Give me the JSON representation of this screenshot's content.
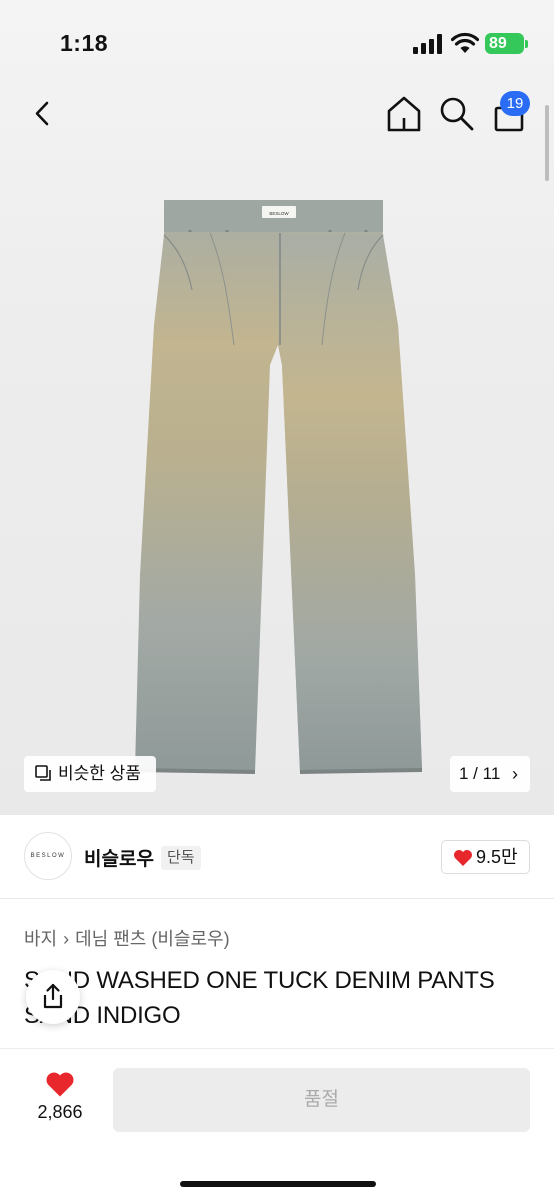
{
  "status_bar": {
    "time": "1:18",
    "battery": "89"
  },
  "nav": {
    "cart_count": "19"
  },
  "gallery": {
    "similar_label": "비슷한 상품",
    "counter": "1 / 11",
    "counter_chevron": "›",
    "brand_print": "BESLOW"
  },
  "shop": {
    "logo_text": "BESLOW",
    "name": "비슬로우",
    "tag": "단독",
    "likes": "9.5만"
  },
  "breadcrumb": {
    "category": "바지",
    "separator": "›",
    "subcategory": "데님 팬츠 (비슬로우)"
  },
  "product": {
    "title": "SAND WASHED ONE TUCK DENIM PANTS SAND INDIGO"
  },
  "bottom_bar": {
    "wish_count": "2,866",
    "action_label": "품절"
  },
  "colors": {
    "accent": "#2a6df4",
    "heart": "#e8272c",
    "battery": "#34c759",
    "denim": "#9aa3a1",
    "sand": "#c7b68d"
  }
}
